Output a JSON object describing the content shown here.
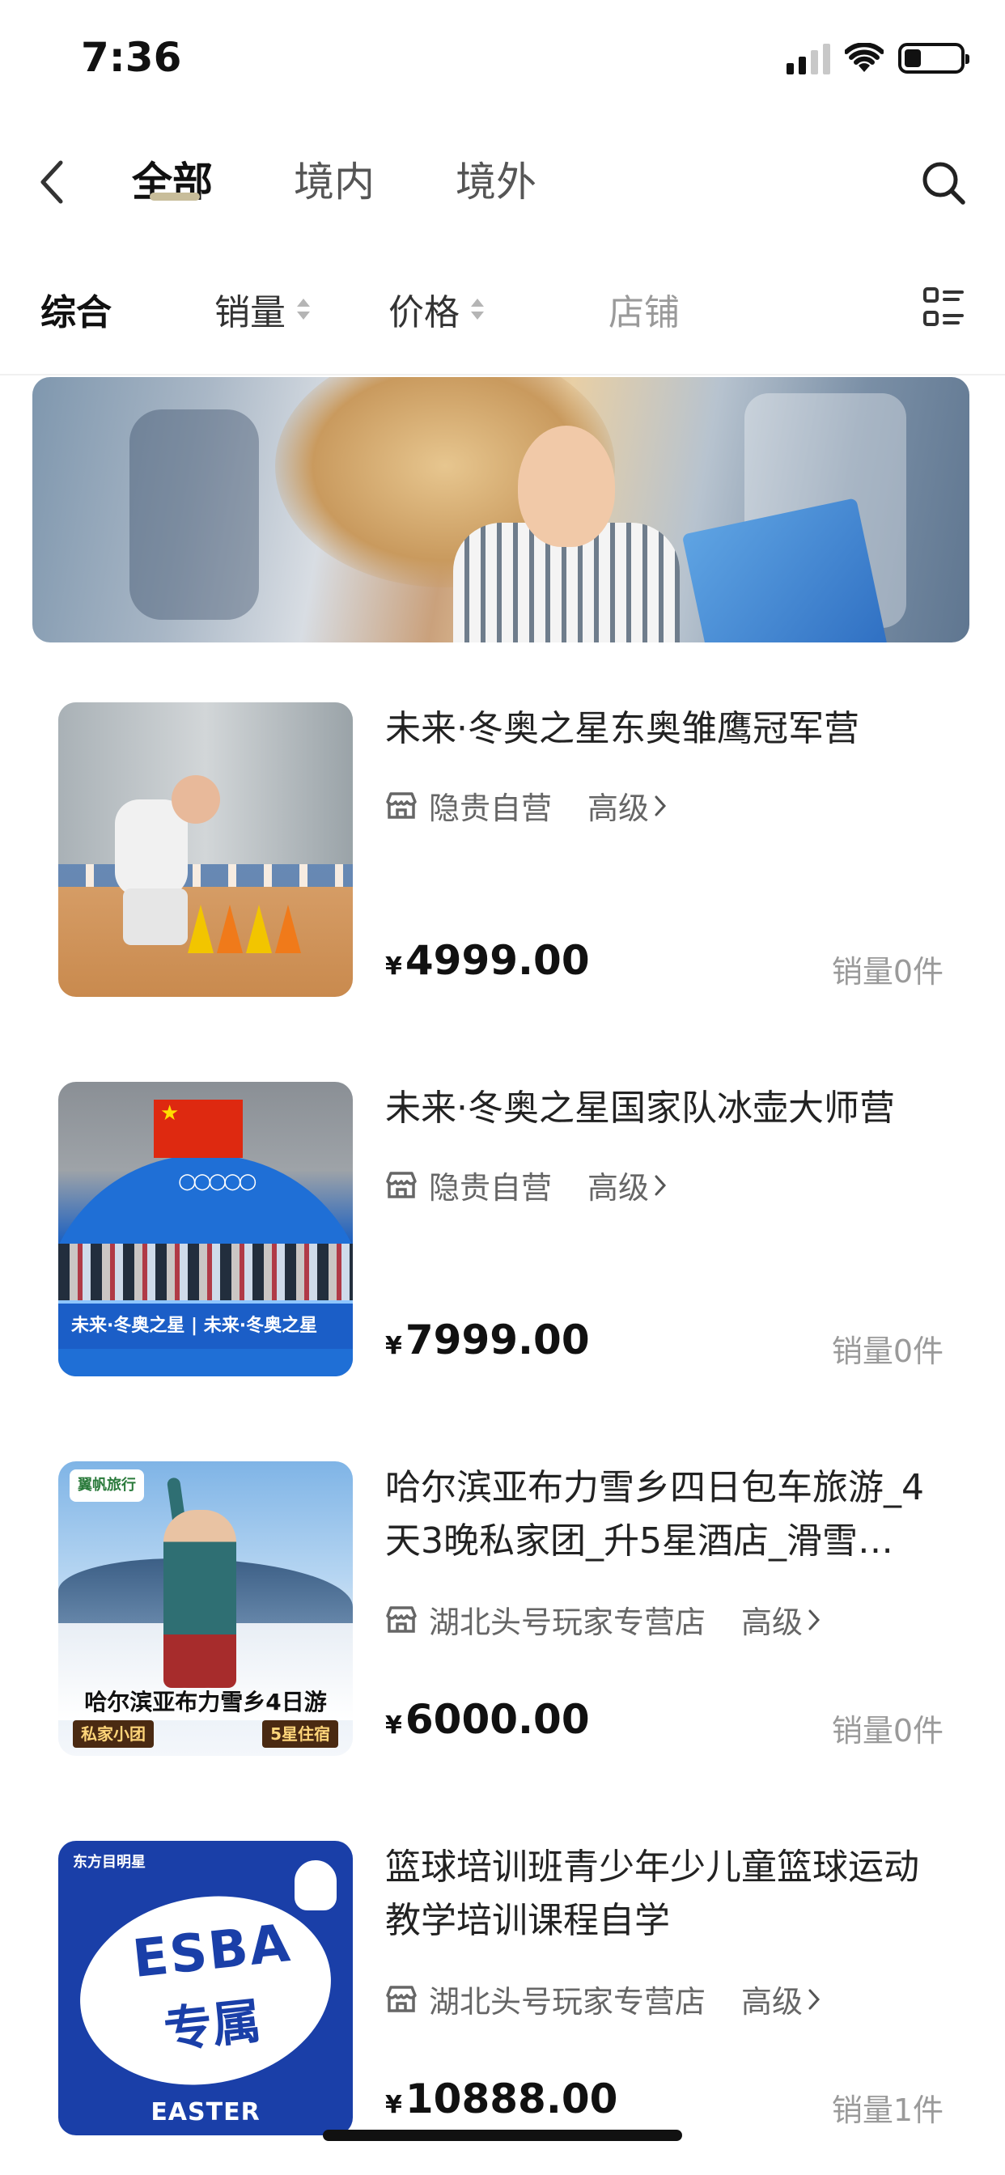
{
  "status_bar": {
    "time": "7:36"
  },
  "header": {
    "tabs": [
      "全部",
      "境内",
      "境外"
    ],
    "active_tab_index": 0,
    "accent_color": "#c8bd9a"
  },
  "sort_bar": {
    "items": [
      "综合",
      "销量",
      "价格",
      "店铺"
    ],
    "active_index": 0
  },
  "products": [
    {
      "title": "未来·冬奥之星东奥雏鹰冠军营",
      "shop": "隐贵自营",
      "level": "高级",
      "currency": "¥",
      "price": "4999.00",
      "sales": "销量0件"
    },
    {
      "title": "未来·冬奥之星国家队冰壶大师营",
      "shop": "隐贵自营",
      "level": "高级",
      "currency": "¥",
      "price": "7999.00",
      "sales": "销量0件",
      "image_text": "未来·冬奥之星 | 未来·冬奥之星"
    },
    {
      "title": "哈尔滨亚布力雪乡四日包车旅游_4天3晚私家团_升5星酒店_滑雪…",
      "shop": "湖北头号玩家专营店",
      "level": "高级",
      "currency": "¥",
      "price": "6000.00",
      "sales": "销量0件",
      "image_logo": "翼帆旅行",
      "image_caption": "哈尔滨亚布力雪乡4日游",
      "image_tag_left": "私家小团",
      "image_tag_right": "5星住宿"
    },
    {
      "title": "篮球培训班青少年少儿童篮球运动教学培训课程自学",
      "shop": "湖北头号玩家专营店",
      "level": "高级",
      "currency": "¥",
      "price": "10888.00",
      "sales": "销量1件",
      "image_logo": "东方目明星",
      "image_main": "ESBA",
      "image_sub": "专属",
      "image_footer": "EASTER"
    }
  ]
}
